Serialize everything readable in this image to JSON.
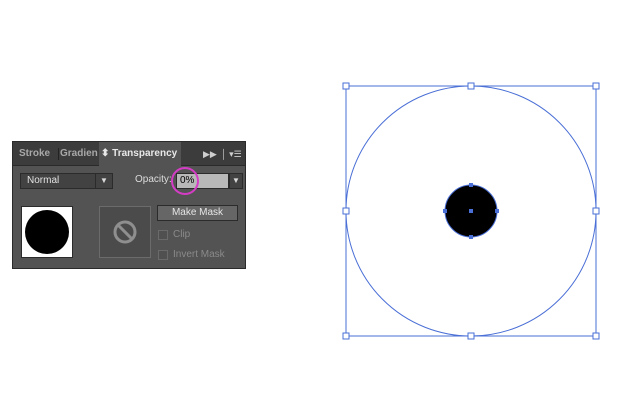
{
  "panel": {
    "tabs": [
      {
        "label": "Stroke"
      },
      {
        "label": "Gradien"
      },
      {
        "label": "⬍ Transparency"
      }
    ],
    "controls": {
      "collapse": "▶▶",
      "menu": "│ ▾☰"
    },
    "blend_mode": "Normal",
    "opacity_label": "Opacity:",
    "opacity_value": "0%",
    "make_mask_label": "Make Mask",
    "clip_label": "Clip",
    "invert_mask_label": "Invert Mask",
    "clip_checked": false,
    "invert_mask_checked": false
  },
  "colors": {
    "selection": "#4a6fd6",
    "highlight": "#d53cc6",
    "panel_bg": "#535353"
  },
  "icons": {
    "blend_arrow": "chevron-down-icon",
    "opacity_arrow": "chevron-down-icon",
    "mask_slot": "no-mask-icon"
  }
}
